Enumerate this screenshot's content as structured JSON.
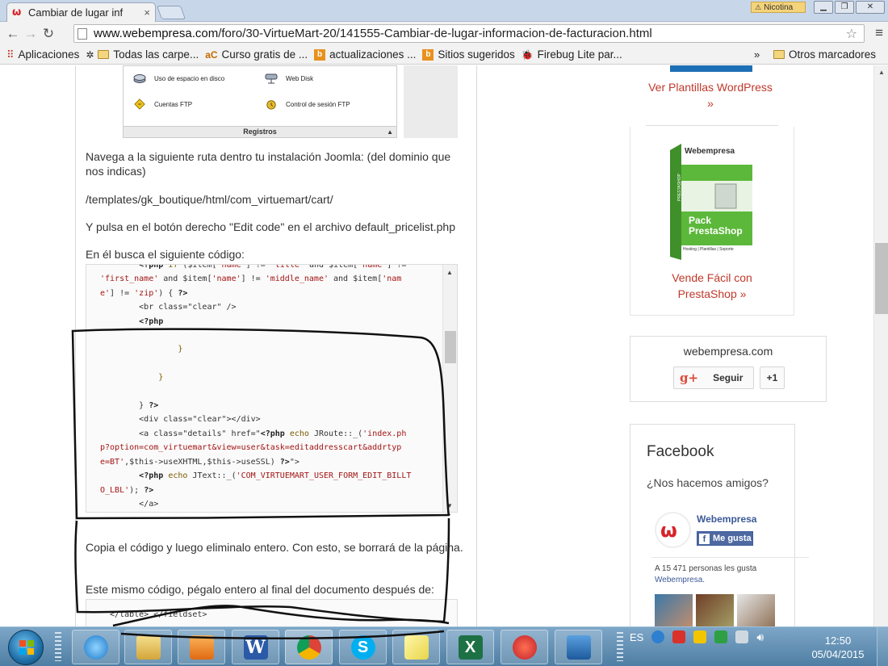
{
  "browser": {
    "tab_title": "Cambiar de lugar inf",
    "tab_close": "×",
    "user_badge": "Nicotina",
    "url_host": "www.webempresa.com",
    "url_path": "/foro/30-VirtueMart-20/141555-Cambiar-de-lugar-informacion-de-facturacion.html",
    "bookmarks": [
      {
        "label": "Aplicaciones",
        "icon": "apps-grid-icon"
      },
      {
        "label": "Todas las carpe...",
        "icon": "folder-icon"
      },
      {
        "label": "Curso gratis de ...",
        "icon": "ac-icon"
      },
      {
        "label": "actualizaciones ...",
        "icon": "b-icon"
      },
      {
        "label": "Sitios sugeridos",
        "icon": "b-icon"
      },
      {
        "label": "Firebug Lite par...",
        "icon": "firebug-icon"
      }
    ],
    "bookmarks_more": "»",
    "other_bookmarks": "Otros marcadores"
  },
  "cpanel": {
    "items": [
      "Uso de espacio en disco",
      "Web Disk",
      "Cuentas FTP",
      "Control de sesión FTP"
    ],
    "footer": "Registros",
    "footer_arrow": "▲"
  },
  "article": {
    "p1": "Navega a la siguiente ruta dentro tu instalación Joomla: (del dominio que nos indicas)",
    "p2": "/templates/gk_boutique/html/com_virtuemart/cart/",
    "p3": "Y pulsa en el botón derecho \"Edit code\" en el archivo default_pricelist.php",
    "p4": "En él busca el siguiente código:",
    "p5": "Copia el código y luego eliminalo entero. Con esto, se borrará de la página.",
    "p6": "Este mismo código, pégalo entero al final del documento después de:",
    "code2": "  </table> </fieldset>"
  },
  "sidebar": {
    "wp_link_line1": "Ver Plantillas WordPress",
    "wp_link_line2": "»",
    "pack_title": "Pack PrestaShop",
    "pack_brand": "Webempresa",
    "pack_sub": "Hosting | Plantillas | Soporte",
    "pack_side": "PRESTASHOP",
    "ps_link_line1": "Vende Fácil con",
    "ps_link_line2": "PrestaShop »",
    "follow_name": "webempresa.com",
    "follow_label": "Seguir",
    "follow_g": "g+",
    "plus_one": "+1",
    "fb_title": "Facebook",
    "fb_subtitle": "¿Nos hacemos amigos?",
    "fb_page_name": "Webempresa",
    "fb_like": "Me gusta",
    "fb_count_text": "A 15 471 personas les gusta",
    "fb_count_link": "Webempresa."
  },
  "taskbar": {
    "lang": "ES",
    "time": "12:50",
    "date": "05/04/2015"
  },
  "colors": {
    "link_red": "#c0392b",
    "facebook_blue": "#3b5998",
    "taskbar": "#5b8ab0"
  }
}
